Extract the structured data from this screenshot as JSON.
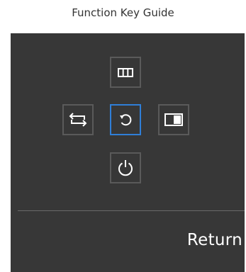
{
  "header": {
    "title": "Function Key Guide"
  },
  "osd": {
    "keys": [
      {
        "position": "up",
        "icon": "picture-mode-icon"
      },
      {
        "position": "left",
        "icon": "source-icon"
      },
      {
        "position": "center",
        "icon": "return-icon",
        "selected": true
      },
      {
        "position": "right",
        "icon": "pip-icon"
      },
      {
        "position": "down",
        "icon": "power-icon"
      }
    ],
    "action_label": "Return"
  },
  "colors": {
    "panel_bg": "#373737",
    "key_border": "#5a5a5a",
    "selected_border": "#2f7fd8",
    "text": "#ffffff"
  }
}
